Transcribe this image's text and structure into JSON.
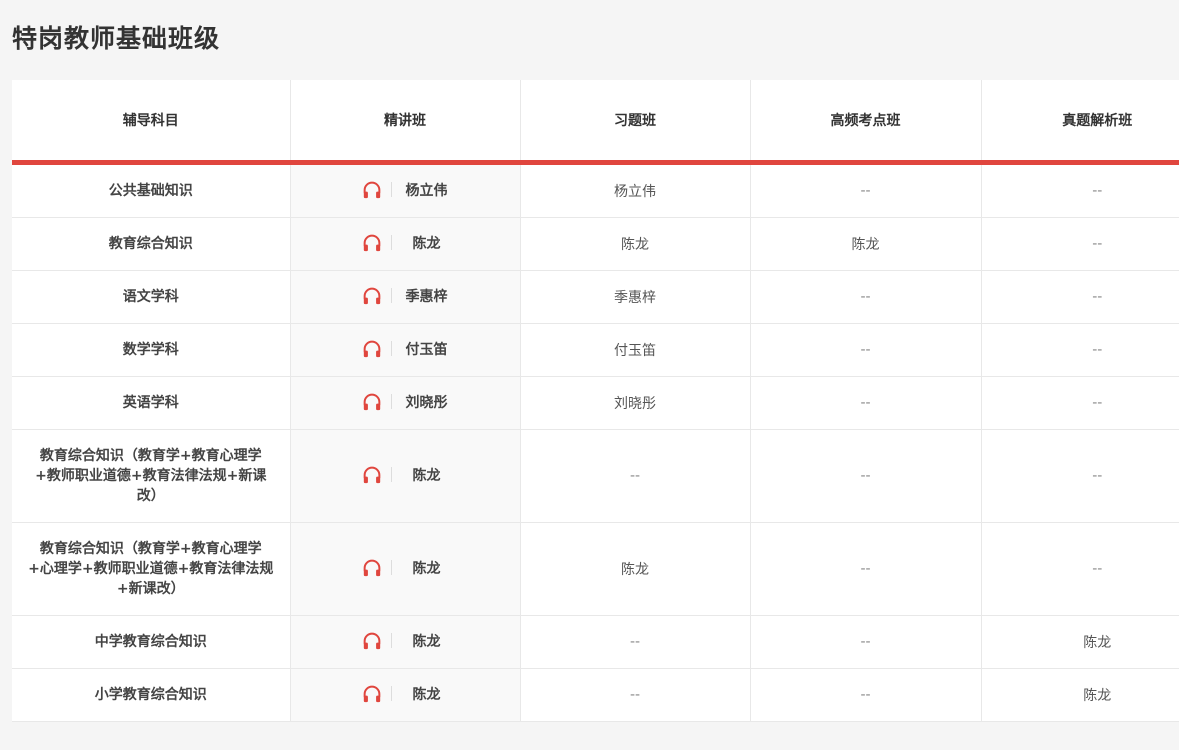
{
  "page": {
    "title": "特岗教师基础班级"
  },
  "table": {
    "headers": [
      "辅导科目",
      "精讲班",
      "习题班",
      "高频考点班",
      "真题解析班"
    ],
    "rows": [
      {
        "subject": "公共基础知识",
        "lecture": "杨立伟",
        "exercise": "杨立伟",
        "highfreq": "--",
        "pastexam": "--"
      },
      {
        "subject": "教育综合知识",
        "lecture": "陈龙",
        "exercise": "陈龙",
        "highfreq": "陈龙",
        "pastexam": "--"
      },
      {
        "subject": "语文学科",
        "lecture": "季惠梓",
        "exercise": "季惠梓",
        "highfreq": "--",
        "pastexam": "--"
      },
      {
        "subject": "数学学科",
        "lecture": "付玉笛",
        "exercise": "付玉笛",
        "highfreq": "--",
        "pastexam": "--"
      },
      {
        "subject": "英语学科",
        "lecture": "刘晓彤",
        "exercise": "刘晓彤",
        "highfreq": "--",
        "pastexam": "--"
      },
      {
        "subject": "教育综合知识（教育学+教育心理学+教师职业道德+教育法律法规+新课改）",
        "lecture": "陈龙",
        "exercise": "--",
        "highfreq": "--",
        "pastexam": "--"
      },
      {
        "subject": "教育综合知识（教育学+教育心理学+心理学+教师职业道德+教育法律法规+新课改）",
        "lecture": "陈龙",
        "exercise": "陈龙",
        "highfreq": "--",
        "pastexam": "--"
      },
      {
        "subject": "中学教育综合知识",
        "lecture": "陈龙",
        "exercise": "--",
        "highfreq": "--",
        "pastexam": "陈龙"
      },
      {
        "subject": "小学教育综合知识",
        "lecture": "陈龙",
        "exercise": "--",
        "highfreq": "--",
        "pastexam": "陈龙"
      }
    ]
  },
  "icons": {
    "lecture_audio": "headphones-icon"
  },
  "colors": {
    "accent": "#e0463e"
  }
}
